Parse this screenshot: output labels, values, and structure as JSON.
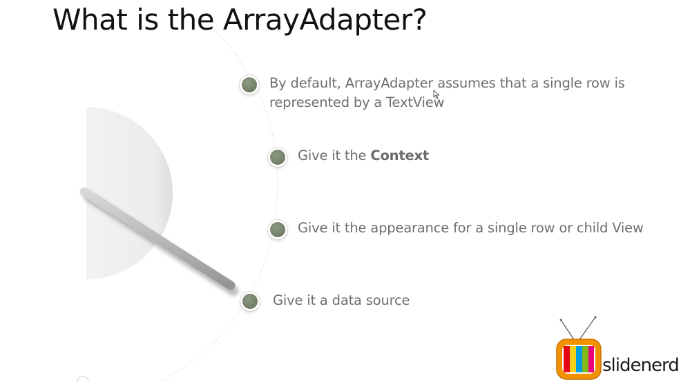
{
  "slide": {
    "title": "What is the ArrayAdapter?",
    "bullets": [
      {
        "pre": "By default, ArrayAdapter assumes that a single row is represented by a TextView",
        "bold": "",
        "post": ""
      },
      {
        "pre": "Give it the ",
        "bold": "Context",
        "post": ""
      },
      {
        "pre": "Give it the appearance for a single row or child View",
        "bold": "",
        "post": ""
      },
      {
        "pre": "Give it a data source",
        "bold": "",
        "post": ""
      }
    ]
  },
  "branding": {
    "wordmark": "slidenerd",
    "logo_icon": "tv-icon",
    "colors": {
      "bullet": "#6f7c66",
      "tv_frame": "#f39200",
      "stripes": [
        "#e30613",
        "#f7d117",
        "#009fe3",
        "#83b81a",
        "#e6007e"
      ]
    }
  }
}
